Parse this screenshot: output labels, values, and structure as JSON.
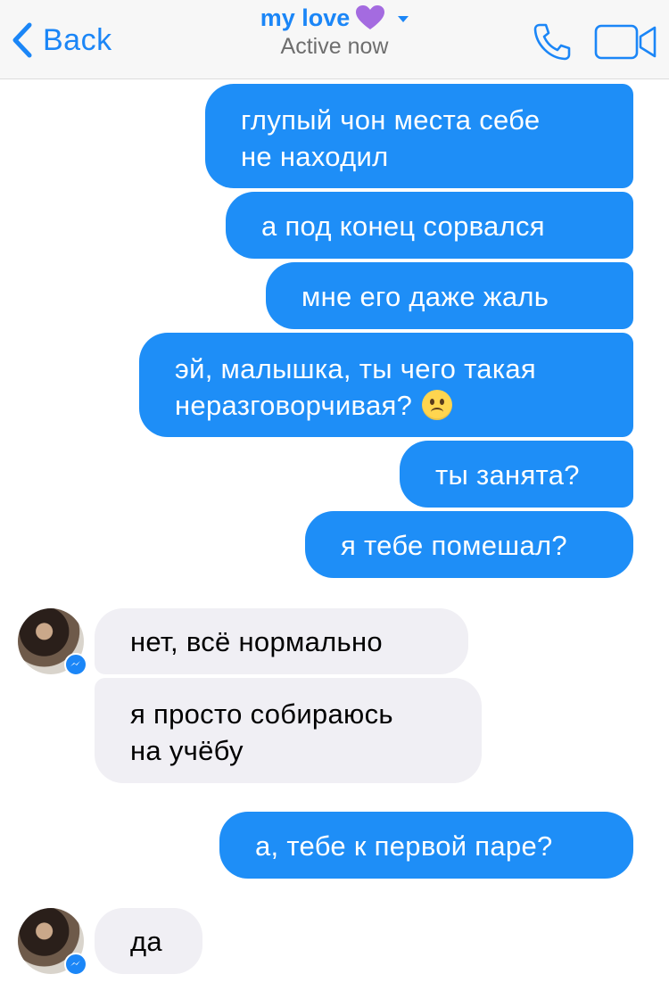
{
  "header": {
    "back_label": "Back",
    "title": "my love",
    "status": "Active now"
  },
  "colors": {
    "accent": "#1b86f7",
    "outgoing_bubble": "#1e8ef7",
    "incoming_bubble": "#f0eff4",
    "heart": "#a46be0"
  },
  "icons": {
    "back": "chevron-left-icon",
    "heart": "purple-heart-icon",
    "caret": "caret-down-icon",
    "call": "phone-icon",
    "video": "video-camera-icon",
    "badge": "messenger-icon"
  },
  "messages": [
    {
      "direction": "out",
      "text": "глупый чон места себе\nне находил"
    },
    {
      "direction": "out",
      "text": "а под конец сорвался"
    },
    {
      "direction": "out",
      "text": "мне его даже жаль"
    },
    {
      "direction": "out",
      "text": "эй, малышка, ты чего такая\nнеразговорчивая?",
      "emoji": "frowning-face"
    },
    {
      "direction": "out",
      "text": "ты занята?"
    },
    {
      "direction": "out",
      "text": "я тебе помешал?"
    },
    {
      "direction": "in",
      "text": "нет, всё нормально"
    },
    {
      "direction": "in",
      "text": "я просто собираюсь\nна учёбу"
    },
    {
      "direction": "out",
      "text": "а, тебе к первой паре?"
    },
    {
      "direction": "in",
      "text": "да"
    }
  ]
}
